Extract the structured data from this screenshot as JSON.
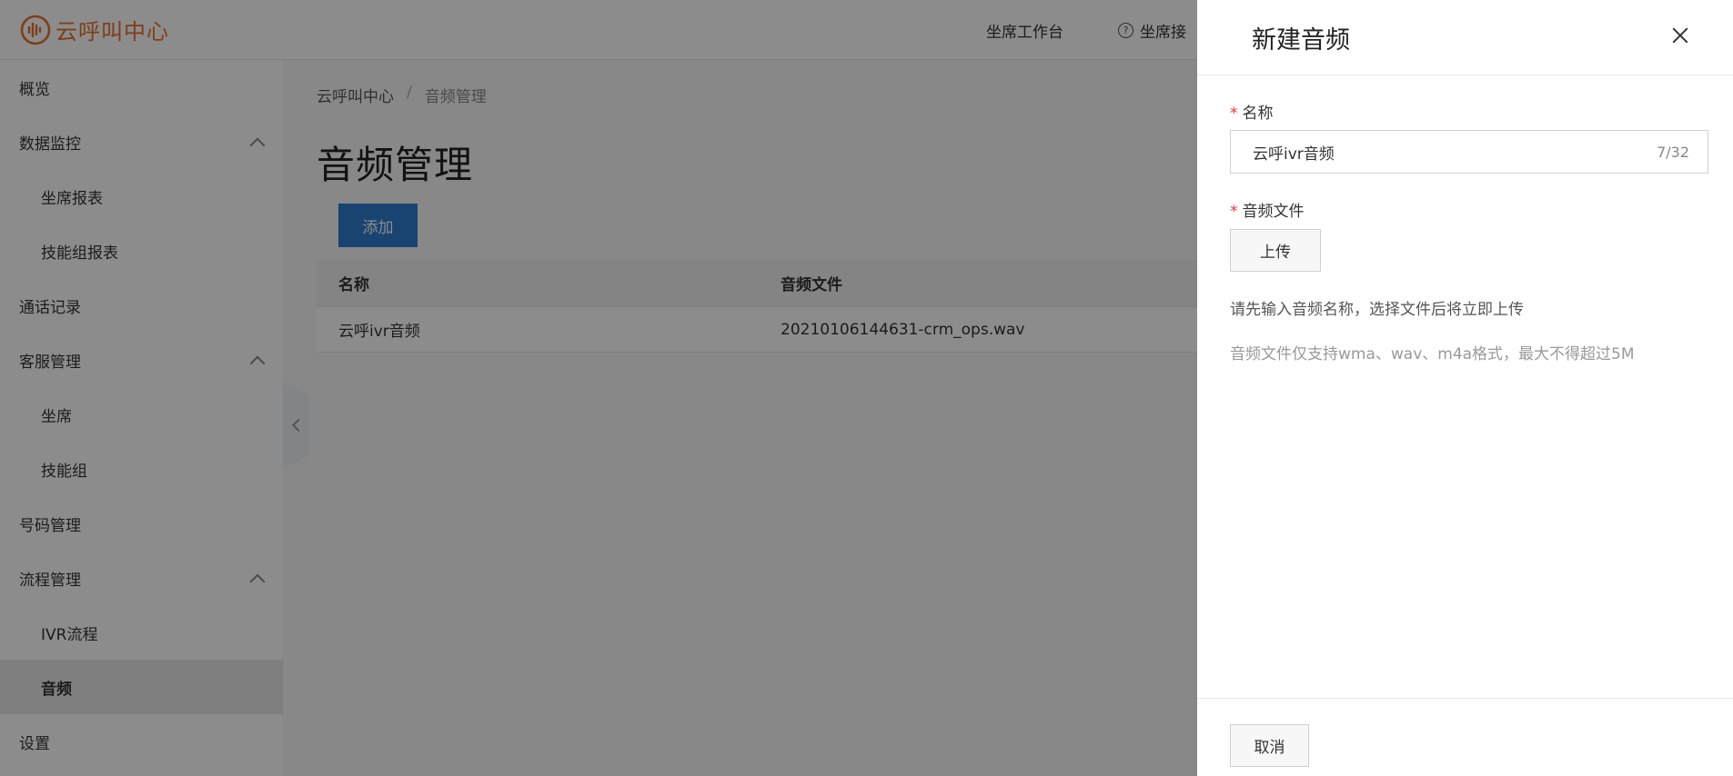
{
  "header": {
    "logo_text": "云呼叫中心",
    "workbench_link": "坐席工作台",
    "help_link": "坐席接",
    "brand_color": "#e8722c"
  },
  "sidebar": {
    "items": [
      {
        "label": "概览"
      },
      {
        "label": "数据监控",
        "expanded": true
      },
      {
        "label": "坐席报表"
      },
      {
        "label": "技能组报表"
      },
      {
        "label": "通话记录"
      },
      {
        "label": "客服管理",
        "expanded": true
      },
      {
        "label": "坐席"
      },
      {
        "label": "技能组"
      },
      {
        "label": "号码管理"
      },
      {
        "label": "流程管理",
        "expanded": true
      },
      {
        "label": "IVR流程"
      },
      {
        "label": "音频",
        "active": true
      },
      {
        "label": "设置"
      }
    ]
  },
  "main": {
    "breadcrumb": [
      "云呼叫中心",
      "/",
      "音频管理"
    ],
    "title": "音频管理",
    "add_button": "添加",
    "table": {
      "columns": [
        "名称",
        "音频文件"
      ],
      "rows": [
        [
          "云呼ivr音频",
          "20210106144631-crm_ops.wav"
        ]
      ]
    }
  },
  "drawer": {
    "title": "新建音频",
    "name_label": "名称",
    "name_value": "云呼ivr音频",
    "name_count": "7/32",
    "file_label": "音频文件",
    "upload_button": "上传",
    "hint_1": "请先输入音频名称，选择文件后将立即上传",
    "hint_2": "音频文件仅支持wma、wav、m4a格式，最大不得超过5M",
    "cancel_button": "取消",
    "required_mark": "*"
  }
}
